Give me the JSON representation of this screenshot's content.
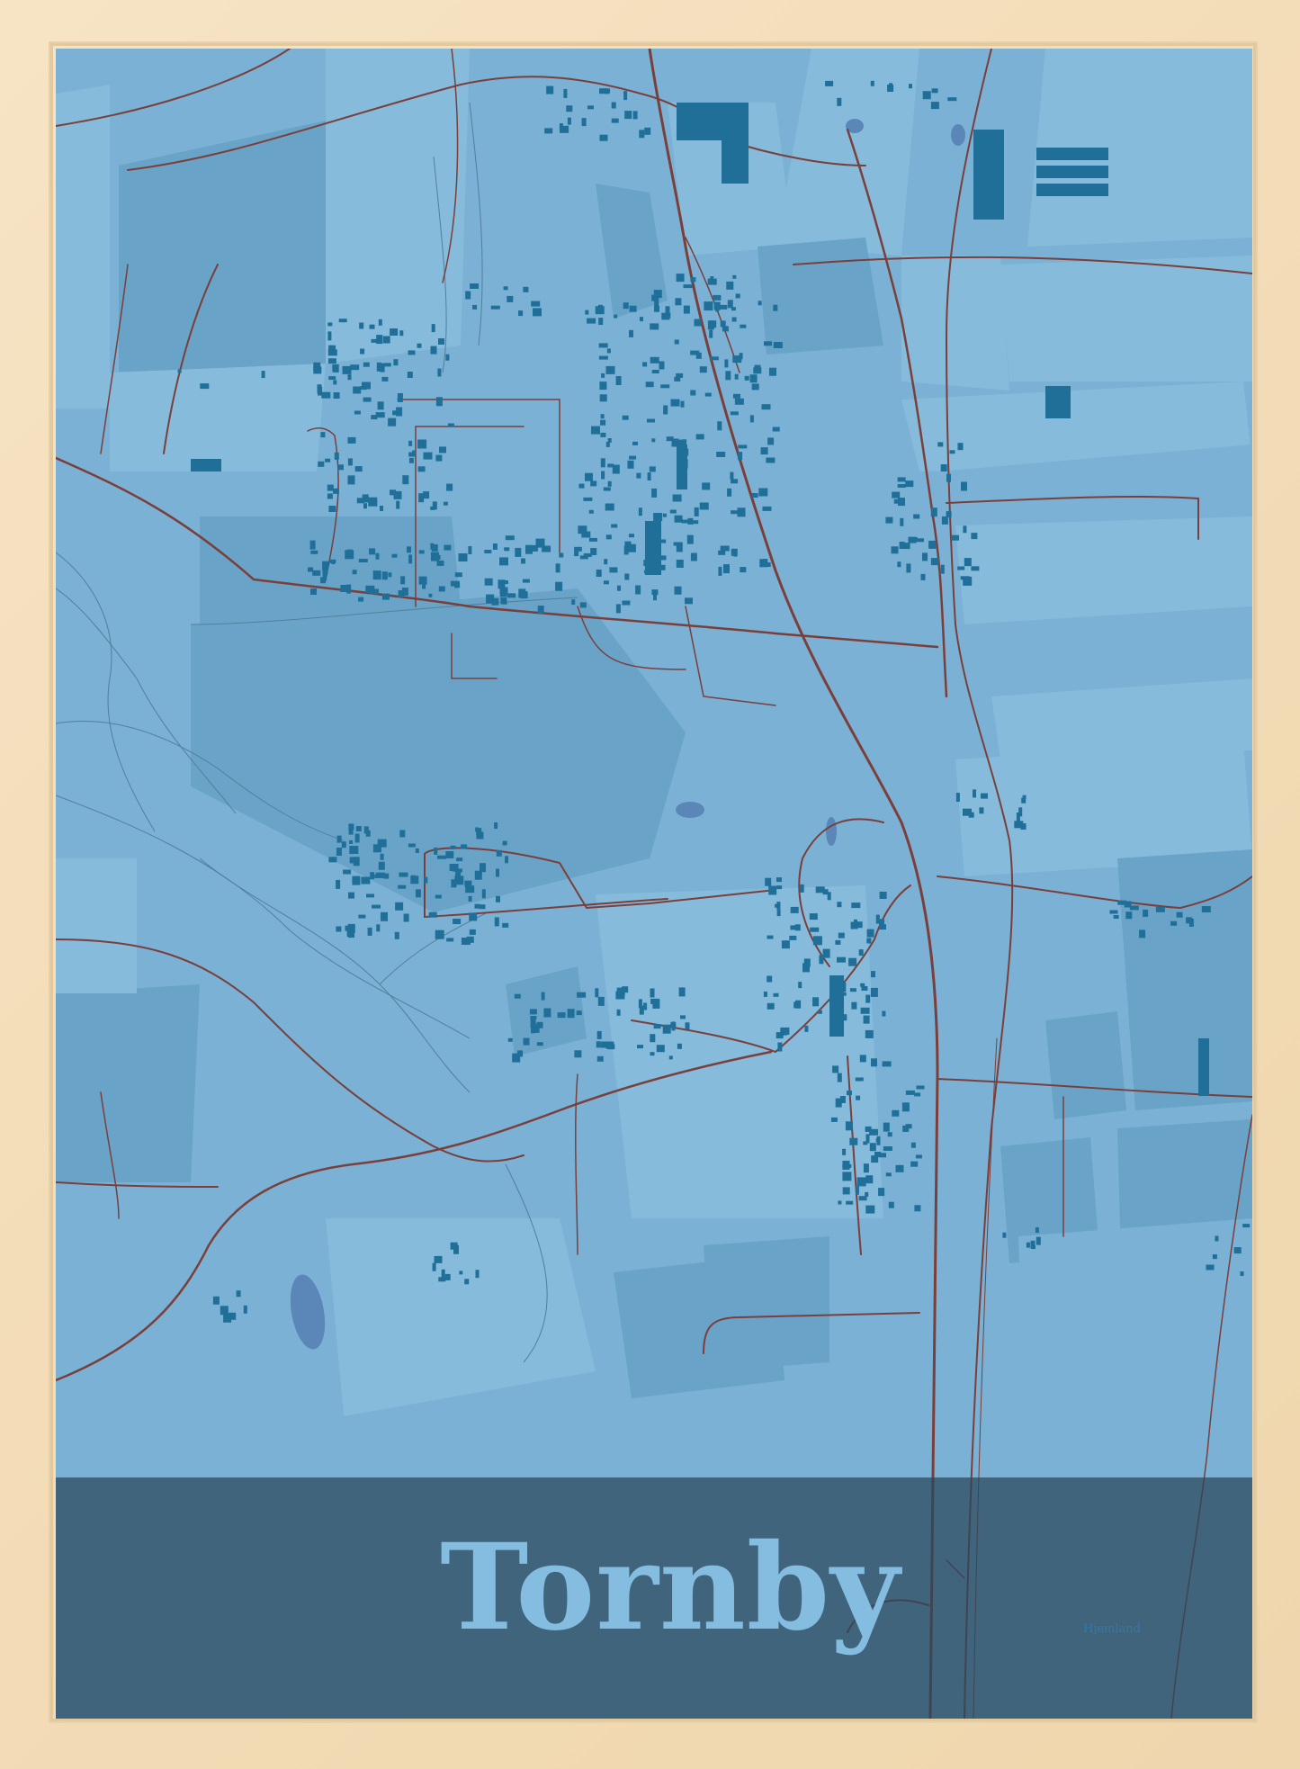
{
  "poster": {
    "title": "Tornby",
    "brand": "Hjemland"
  },
  "colors": {
    "frame": "#f3dcb7",
    "map_base": "#7ab1d4",
    "field_dark": "#6aa3c8",
    "field_light": "#86bbdb",
    "building": "#1f6f99",
    "road": "#7a3f3a",
    "water": "#5b86b8",
    "band": "#2d4a5e",
    "title_text": "#84bde0"
  }
}
